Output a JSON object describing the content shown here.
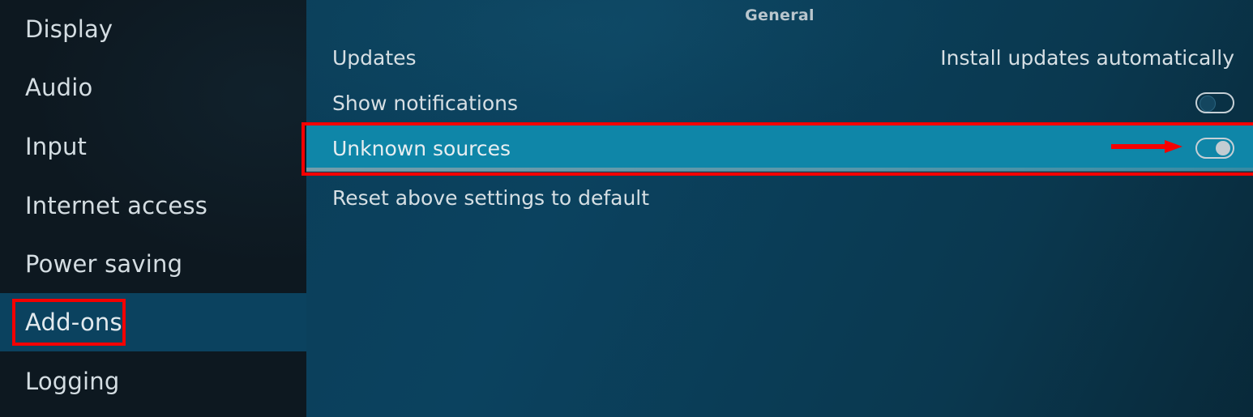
{
  "sidebar": {
    "items": [
      {
        "label": "Display",
        "selected": false
      },
      {
        "label": "Audio",
        "selected": false
      },
      {
        "label": "Input",
        "selected": false
      },
      {
        "label": "Internet access",
        "selected": false
      },
      {
        "label": "Power saving",
        "selected": false
      },
      {
        "label": "Add-ons",
        "selected": true
      },
      {
        "label": "Logging",
        "selected": false
      }
    ]
  },
  "main": {
    "title": "General",
    "rows": [
      {
        "label": "Updates",
        "value": "Install updates automatically",
        "control": "text"
      },
      {
        "label": "Show notifications",
        "value": "off",
        "control": "toggle"
      },
      {
        "label": "Unknown sources",
        "value": "on",
        "control": "toggle"
      },
      {
        "label": "Reset above settings to default",
        "value": "",
        "control": "none"
      }
    ]
  },
  "annotations": {
    "highlight_color": "#f50000",
    "row_box_target": "Unknown sources",
    "sidebar_box_target": "Add-ons",
    "arrow_target": "unknown-sources-toggle"
  },
  "colors": {
    "sidebar_bg": "#0d1820",
    "panel_bg": "#0b425f",
    "row_highlight": "#0f86a8",
    "selected_item": "#0b425f",
    "text": "#d6dfe4",
    "annotation": "#f50000"
  }
}
